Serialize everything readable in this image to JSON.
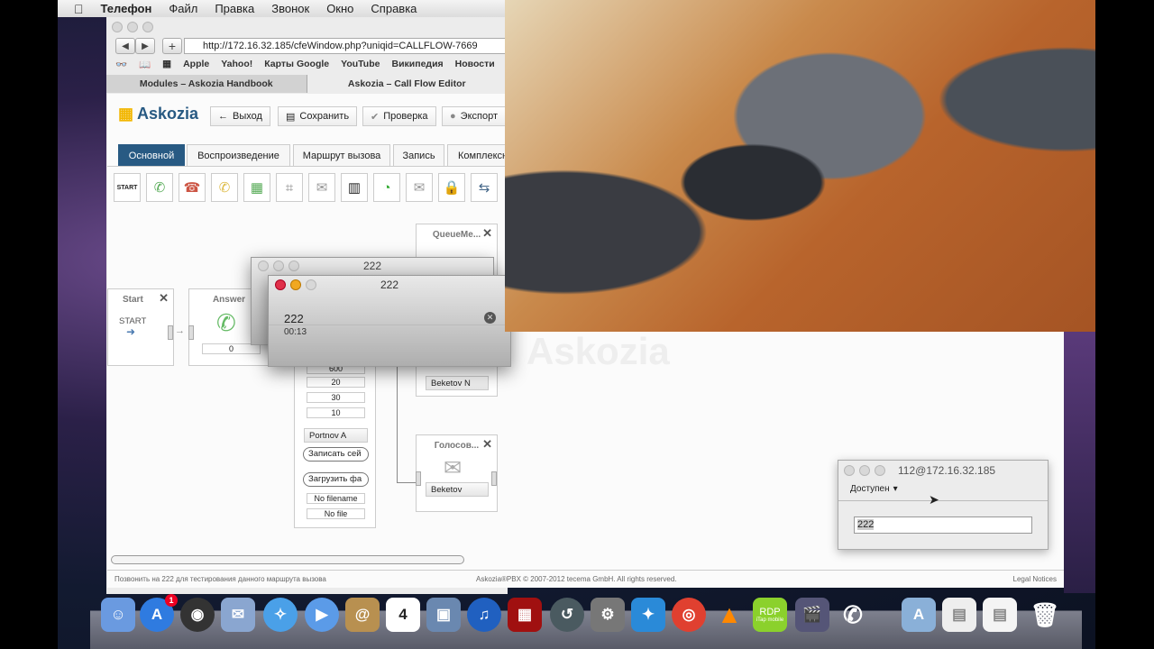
{
  "menubar": {
    "app": "Телефон",
    "items": [
      "Файл",
      "Правка",
      "Звонок",
      "Окно",
      "Справка"
    ]
  },
  "browser": {
    "url": "http://172.16.32.185/cfeWindow.php?uniqid=CALLFLOW-7669",
    "bookmarks": [
      "Apple",
      "Yahoo!",
      "Карты Google",
      "YouTube",
      "Википедия",
      "Новости"
    ],
    "tabs": [
      "Modules – Askozia Handbook",
      "Askozia – Call Flow Editor"
    ]
  },
  "app": {
    "logo": "Askozia",
    "buttons": {
      "exit": "Выход",
      "save": "Сохранить",
      "check": "Проверка",
      "export": "Экспорт"
    },
    "tabs": [
      "Основной",
      "Воспроизведение",
      "Маршрут вызова",
      "Запись",
      "Комплексн"
    ],
    "tools": [
      "start",
      "answer",
      "hangup",
      "ringing",
      "dial",
      "keypad",
      "voicemail",
      "piano",
      "time",
      "email",
      "lock",
      "transfer"
    ],
    "nodes": {
      "start": {
        "title": "Start",
        "label": "START"
      },
      "answer": {
        "title": "Answer",
        "value": "0"
      },
      "queue": {
        "title": "QueueMe...",
        "select": "Beketov N"
      },
      "voicemail": {
        "title": "Голосов...",
        "select": "Beketov"
      },
      "mid": {
        "f0": "600",
        "f1": "20",
        "f2": "30",
        "f3": "10",
        "select": "Portnov A",
        "record": "Записать сей",
        "upload": "Загрузить фа",
        "filename": "No filename",
        "file": "No file"
      }
    },
    "watermark": "Askozia",
    "footer": {
      "left": "Позвонить на 222 для тестирования данного маршрута вызова",
      "center": "Askozia®PBX © 2007-2012 tecema GmbH. All rights reserved.",
      "right": "Legal Notices"
    }
  },
  "call_popup_back": {
    "title": "222"
  },
  "call_popup": {
    "title": "222",
    "number": "222",
    "duration": "00:13"
  },
  "sip_window": {
    "title": "112@172.16.32.185",
    "status": "Доступен",
    "input": "222"
  },
  "dock": {
    "badge": "1",
    "calendar_day": "4",
    "rdp_label": "RDP",
    "rdp_sub": "iTap mobile"
  }
}
